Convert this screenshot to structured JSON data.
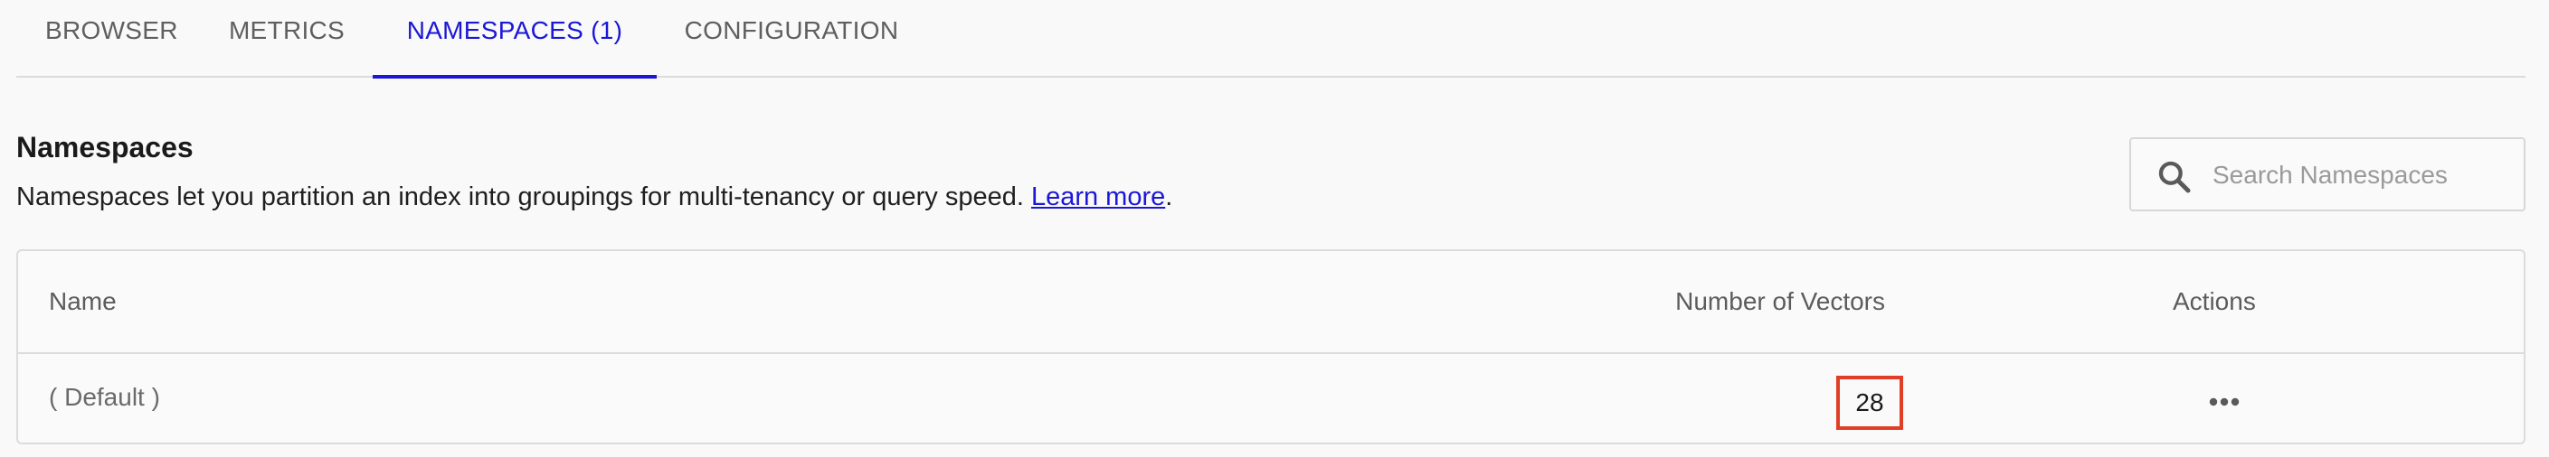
{
  "tabs": [
    {
      "label": "BROWSER"
    },
    {
      "label": "METRICS"
    },
    {
      "label": "NAMESPACES (1)"
    },
    {
      "label": "CONFIGURATION"
    }
  ],
  "active_tab": "NAMESPACES (1)",
  "section": {
    "title": "Namespaces",
    "description": "Namespaces let you partition an index into groupings for multi-tenancy or query speed. ",
    "link_text": "Learn more",
    "trailing": "."
  },
  "search": {
    "placeholder": "Search Namespaces",
    "value": ""
  },
  "table": {
    "columns": [
      "Name",
      "Number of Vectors",
      "Actions"
    ],
    "rows": [
      {
        "name": "( Default )",
        "vectors": "28"
      }
    ]
  },
  "colors": {
    "accent": "#1c17d6",
    "highlight": "#e03e26",
    "border": "#dcdcdc",
    "background": "#f9f9f9"
  },
  "icons": {
    "search": "search-icon",
    "actions": "more-horizontal-icon"
  }
}
